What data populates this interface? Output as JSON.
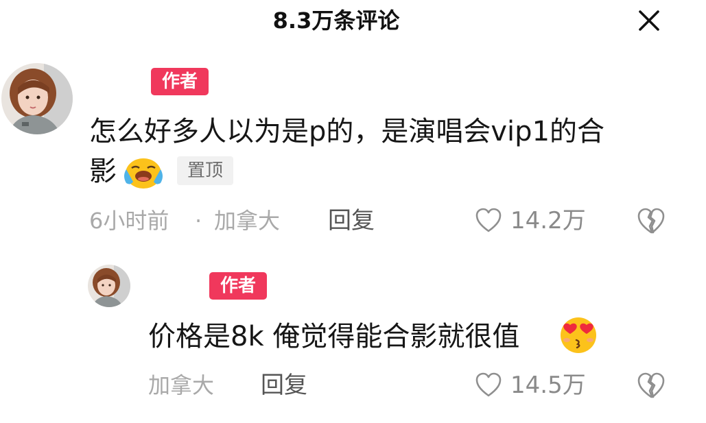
{
  "header": {
    "title": "8.3万条评论"
  },
  "comments": [
    {
      "badge": "作者",
      "text_line1": "怎么好多人以为是p的，是演唱会vip1的合",
      "text_line2": "影",
      "emoji": "crying-face-emoji",
      "pinned_label": "置顶",
      "time": "6小时前",
      "dot": "·",
      "location": "加拿大",
      "reply_label": "回复",
      "like_count": "14.2万"
    },
    {
      "badge": "作者",
      "text": "价格是8k 俺觉得能合影就很值",
      "emoji": "heart-eyes-kiss-emoji",
      "location": "加拿大",
      "reply_label": "回复",
      "like_count": "14.5万"
    }
  ],
  "colors": {
    "author_badge": "#f0385c",
    "meta_gray": "#a9a9a9",
    "text_dark": "#161616"
  }
}
